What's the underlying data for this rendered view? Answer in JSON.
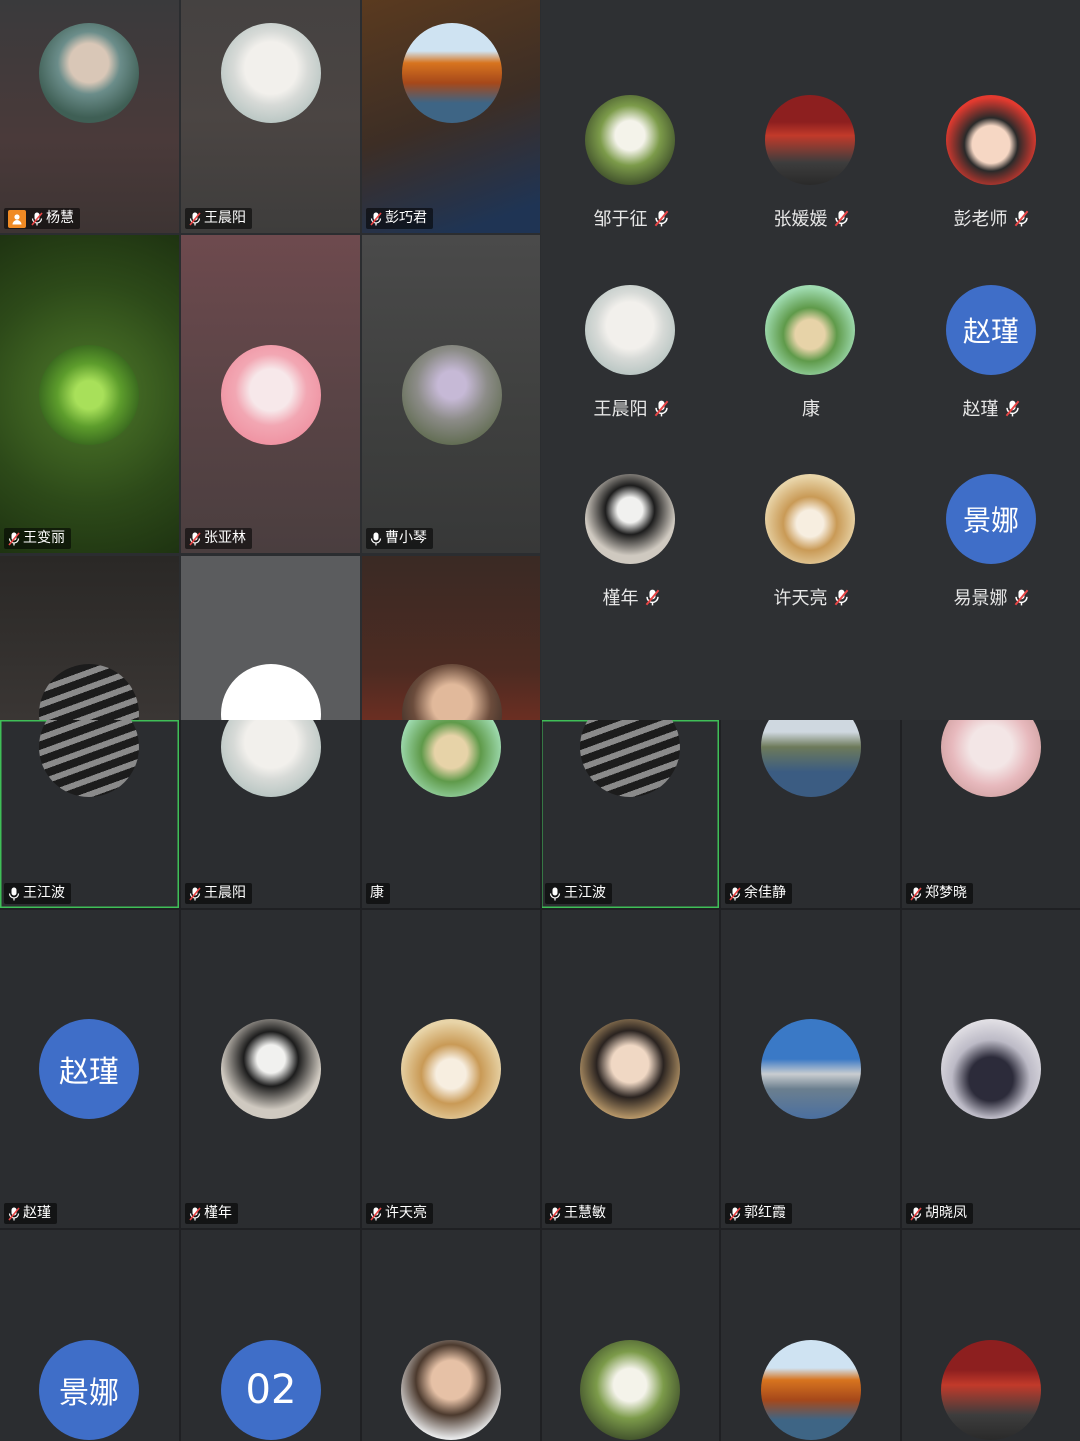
{
  "top_video_grid": [
    {
      "name": "杨慧",
      "host": true
    },
    {
      "name": "王晨阳"
    },
    {
      "name": "彭巧君"
    },
    {
      "name": "王变丽"
    },
    {
      "name": "张亚林"
    },
    {
      "name": "曹小琴"
    }
  ],
  "gallery": [
    {
      "name": "邹于征"
    },
    {
      "name": "张媛媛"
    },
    {
      "name": "彭老师"
    },
    {
      "name": "王晨阳"
    },
    {
      "name": "康"
    },
    {
      "name": "赵瑾",
      "avatar_text": "赵瑾"
    },
    {
      "name": "槿年"
    },
    {
      "name": "许天亮"
    },
    {
      "name": "易景娜",
      "avatar_text": "景娜"
    }
  ],
  "bottom_grid": [
    {
      "name": "王江波"
    },
    {
      "name": "王晨阳"
    },
    {
      "name": "康"
    },
    {
      "name": "王江波"
    },
    {
      "name": "余佳静"
    },
    {
      "name": "郑梦晓"
    },
    {
      "name": "赵瑾",
      "avatar_text": "赵瑾"
    },
    {
      "name": "槿年"
    },
    {
      "name": "许天亮"
    },
    {
      "name": "王慧敏"
    },
    {
      "name": "郭红霞"
    },
    {
      "name": "胡晓凤"
    },
    {
      "avatar_text": "景娜"
    },
    {
      "avatar_text": "02"
    },
    {},
    {},
    {},
    {}
  ],
  "colors": {
    "avatar_blue": "#3f6ec8",
    "active_speaker": "#3fbf57",
    "host_badge": "#f08a24"
  }
}
